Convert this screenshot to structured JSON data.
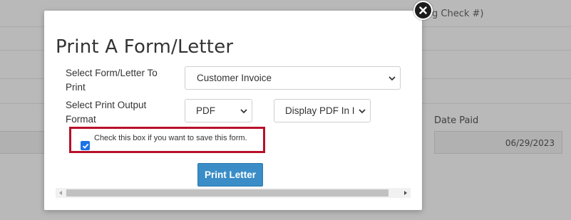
{
  "background": {
    "heading_fragment": "g Check #)",
    "date_paid_label": "Date Paid",
    "date_paid_value": "06/29/2023"
  },
  "modal": {
    "title": "Print A Form/Letter",
    "form_label": "Select Form/Letter To Print",
    "form_selected": "Customer Invoice",
    "format_label": "Select Print Output Format",
    "output_selected": "PDF",
    "display_selected": "Display PDF In I",
    "save_checkbox_label": "Check this box if you want to save this form.",
    "save_checked": true,
    "print_button": "Print Letter"
  },
  "colors": {
    "highlight_border": "#b8112a",
    "print_button_bg": "#3a8dc7",
    "checkbox_accent": "#1a73e8"
  },
  "icons": {
    "close": "close-icon",
    "dropdown": "chevron-down-icon",
    "checkbox": "checkmark-icon",
    "scroll_left": "triangle-left-icon",
    "scroll_right": "triangle-right-icon"
  }
}
